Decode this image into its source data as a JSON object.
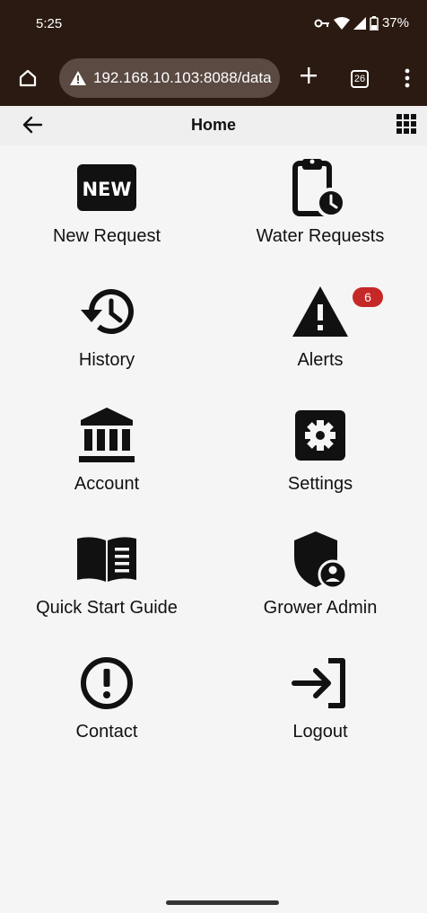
{
  "status_bar": {
    "time": "5:25",
    "battery_pct": "37%"
  },
  "browser": {
    "url": "192.168.10.103:8088/data",
    "tab_count": "26"
  },
  "app_bar": {
    "title": "Home"
  },
  "tiles": [
    {
      "label": "New Request",
      "icon": "new-badge-icon"
    },
    {
      "label": "Water Requests",
      "icon": "clipboard-clock-icon"
    },
    {
      "label": "History",
      "icon": "history-icon"
    },
    {
      "label": "Alerts",
      "icon": "warning-triangle-icon",
      "badge": "6"
    },
    {
      "label": "Account",
      "icon": "bank-icon"
    },
    {
      "label": "Settings",
      "icon": "gear-icon"
    },
    {
      "label": "Quick Start Guide",
      "icon": "open-book-icon"
    },
    {
      "label": "Grower Admin",
      "icon": "shield-user-icon"
    },
    {
      "label": "Contact",
      "icon": "exclamation-circle-icon"
    },
    {
      "label": "Logout",
      "icon": "logout-icon"
    }
  ],
  "colors": {
    "status_bg": "#2b1a11",
    "badge_red": "#c62828",
    "page_bg": "#f5f5f5"
  }
}
